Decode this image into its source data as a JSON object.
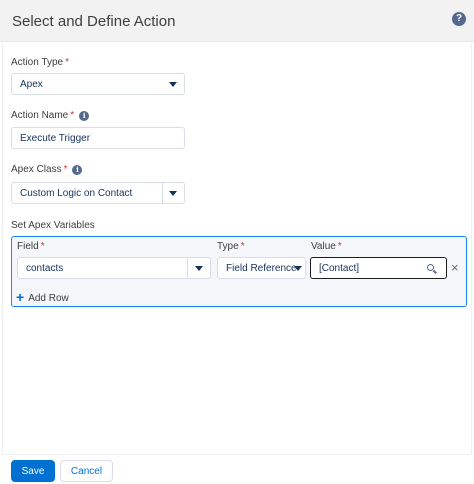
{
  "dialog": {
    "title": "Select and Define Action",
    "help_icon": "question-circle-icon"
  },
  "form": {
    "action_type": {
      "label": "Action Type",
      "value": "Apex"
    },
    "action_name": {
      "label": "Action Name",
      "value": "Execute Trigger"
    },
    "apex_class": {
      "label": "Apex Class",
      "value": "Custom Logic on Contact"
    },
    "required_marker": "*",
    "info_glyph": "i",
    "set_apex_variables": {
      "label": "Set Apex Variables",
      "columns": {
        "field": "Field",
        "type": "Type",
        "value": "Value"
      },
      "rows": [
        {
          "field": "contacts",
          "type": "Field Reference",
          "value": "[Contact]"
        }
      ],
      "add_row_label": "Add Row",
      "add_row_glyph": "+",
      "remove_glyph": "×"
    }
  },
  "footer": {
    "save_label": "Save",
    "cancel_label": "Cancel"
  },
  "colors": {
    "brand": "#0070d2",
    "required": "#c23934",
    "focus_border": "#1589ee",
    "header_bg": "#f3f2f2"
  }
}
